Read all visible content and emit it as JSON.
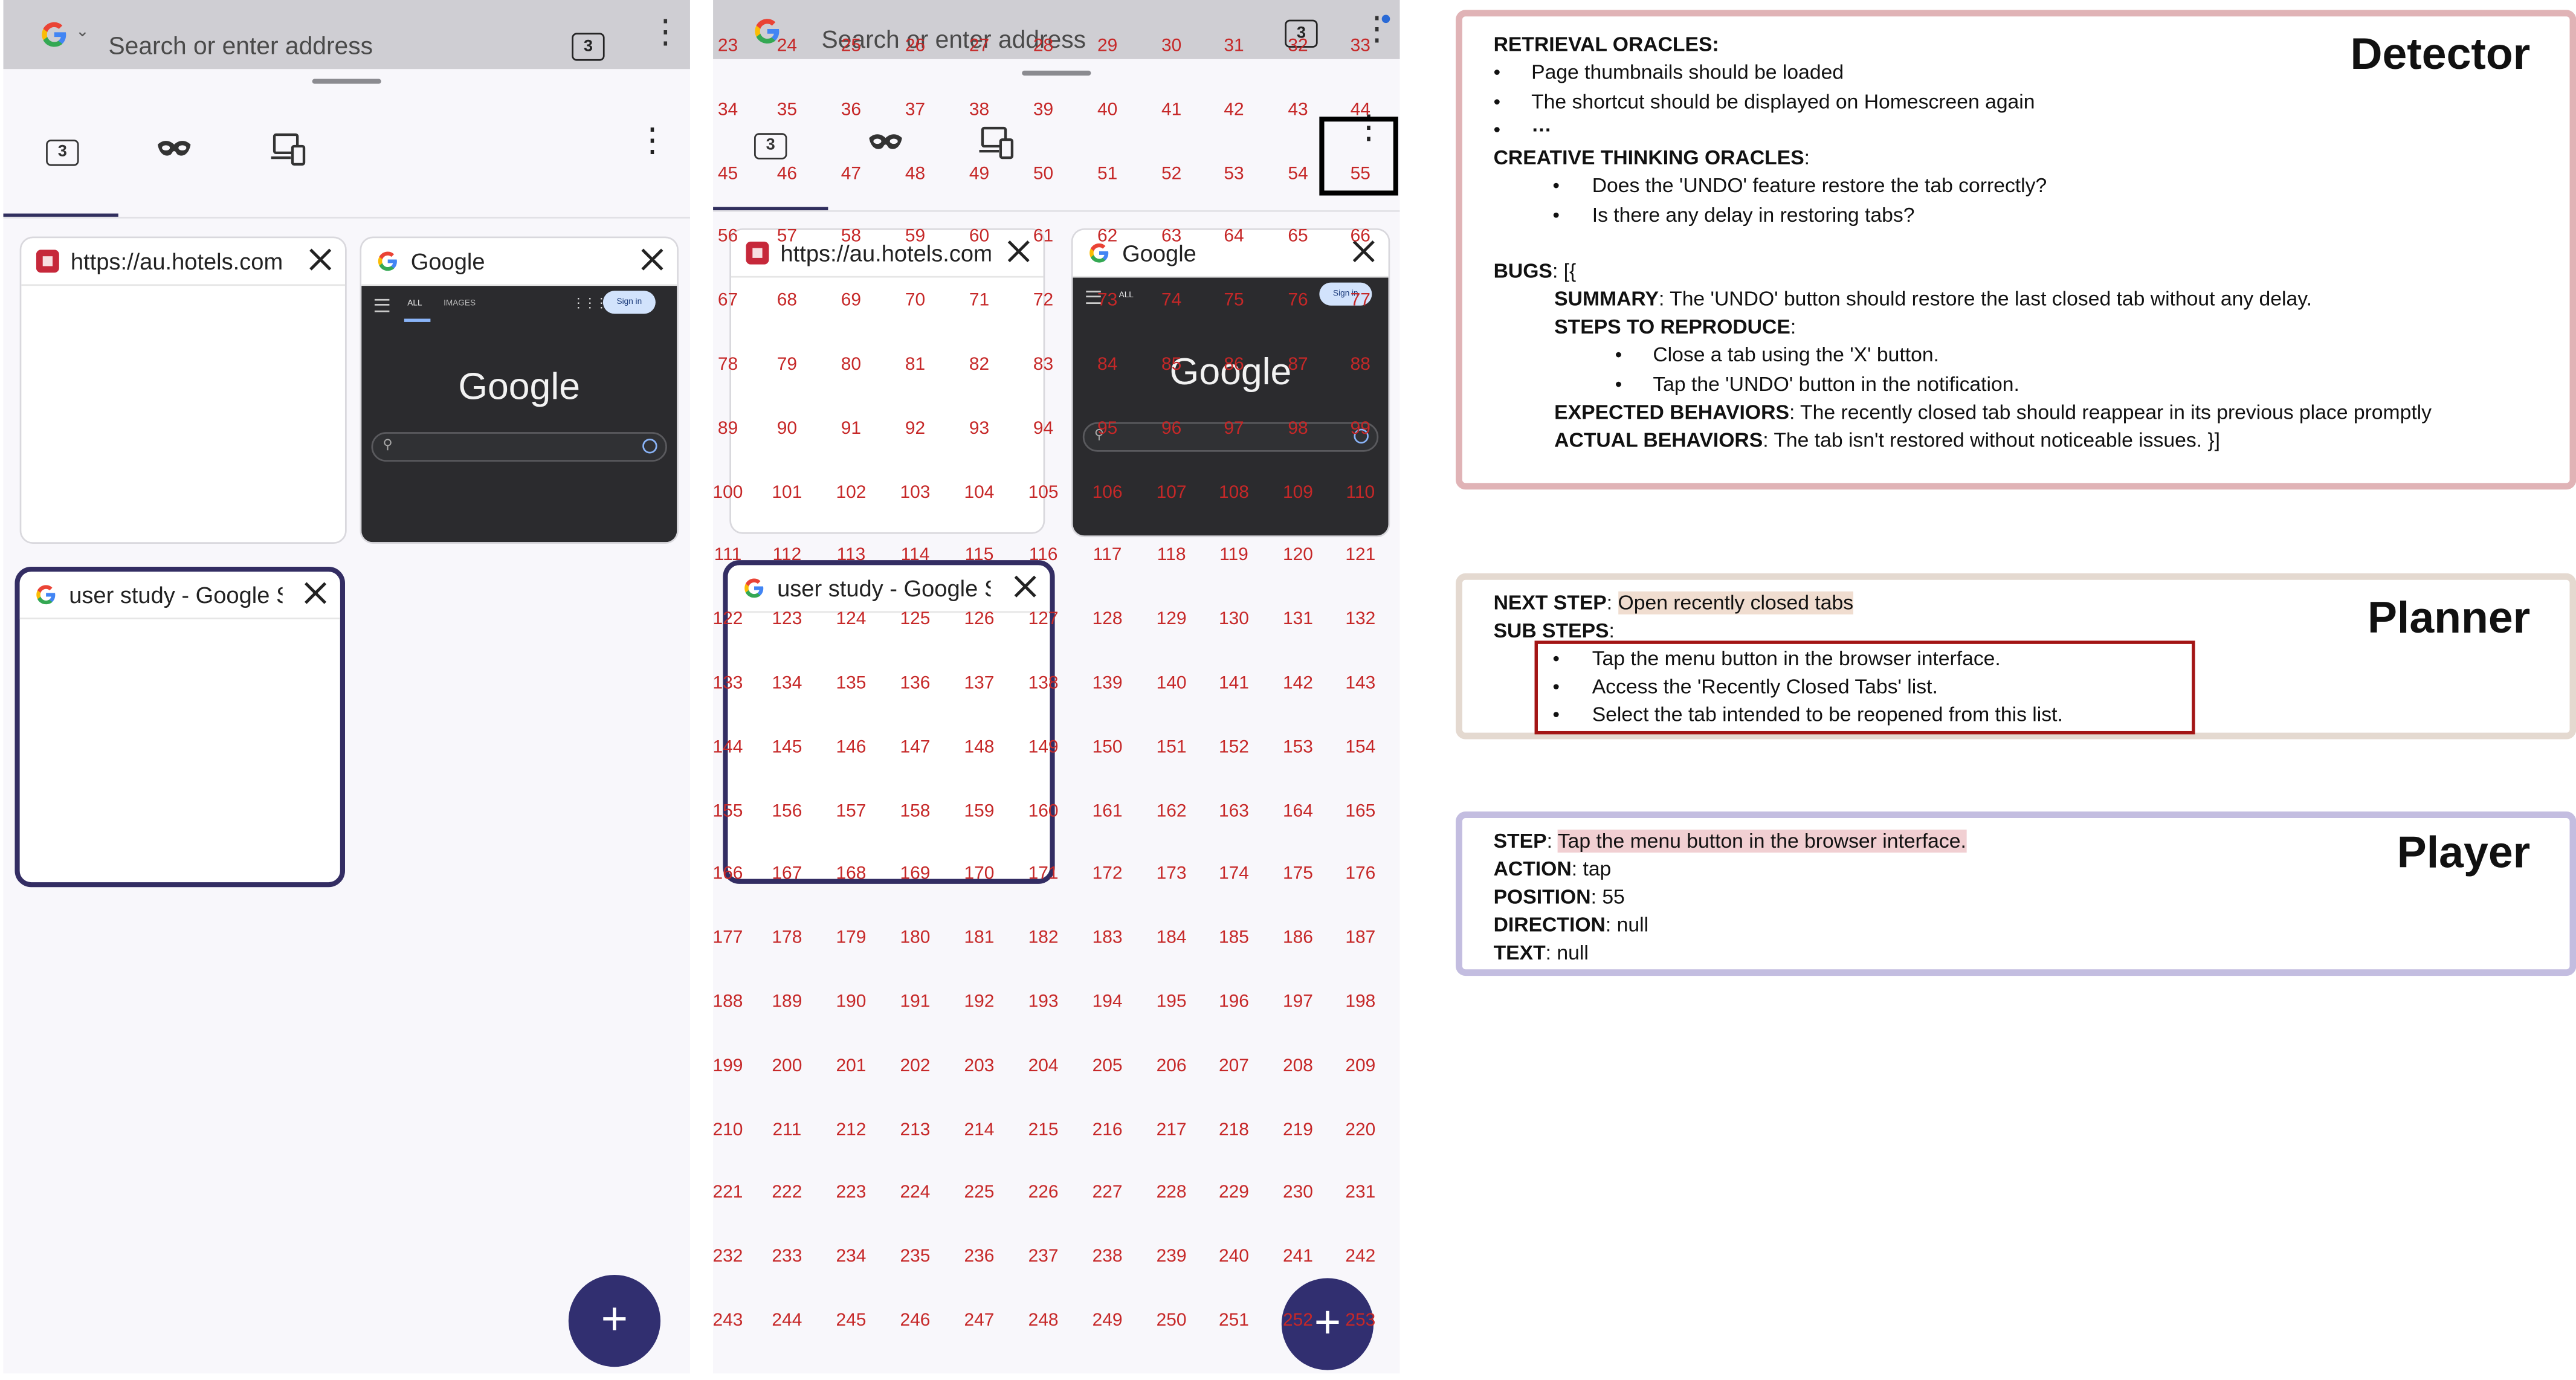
{
  "phone_left": {
    "urlbar": {
      "placeholder": "Search or enter address",
      "tab_count": "3"
    },
    "tabs_tray": {
      "normal_count": "3"
    },
    "cards": [
      {
        "title": "https://au.hotels.com",
        "favicon": "hotels-favicon",
        "thumbnail": "blank"
      },
      {
        "title": "Google",
        "favicon": "google-favicon",
        "thumbnail": "google-homepage-dark"
      },
      {
        "title": "user study - Google Search",
        "favicon": "google-favicon",
        "thumbnail": "blank"
      }
    ],
    "google_thumbnail": {
      "nav_all": "ALL",
      "nav_images": "IMAGES",
      "sign_in": "Sign in",
      "logo": "Google"
    },
    "fab_label": "+"
  },
  "phone_right": {
    "urlbar": {
      "placeholder": "Search or enter address",
      "tab_count": "3"
    },
    "tabs_tray": {
      "normal_count": "3"
    },
    "cards": [
      {
        "title": "https://au.hotels.com"
      },
      {
        "title": "Google"
      },
      {
        "title": "user study - Google Search"
      }
    ],
    "google_thumbnail": {
      "nav_all": "ALL",
      "sign_in": "Sign in",
      "logo": "Google"
    },
    "fab_label": "+",
    "grid_labels": {
      "first": 23,
      "last": 253,
      "columns": 11,
      "highlighted": 55
    }
  },
  "detector": {
    "heading": "Detector",
    "retrieval_label": "RETRIEVAL ORACLES:",
    "retrieval_items": [
      "Page thumbnails should be loaded",
      "The shortcut should be displayed on Homescreen again",
      "…"
    ],
    "creative_label": "CREATIVE THINKING ORACLES",
    "creative_items": [
      "Does the 'UNDO' feature restore the tab correctly?",
      "Is there any delay in restoring tabs?"
    ],
    "bugs_label": "BUGS",
    "bugs_open": ": [{",
    "summary_label": "SUMMARY",
    "summary_text": ": The 'UNDO' button should restore the last closed tab without any delay.",
    "steps_label": "STEPS TO REPRODUCE",
    "steps_items": [
      "Close a tab using the 'X' button.",
      "Tap the 'UNDO' button in the notification."
    ],
    "expected_label": "EXPECTED BEHAVIORS",
    "expected_text": ": The recently closed tab should reappear in its previous place promptly",
    "actual_label": "ACTUAL BEHAVIORS",
    "actual_text": ": The tab isn't restored without noticeable issues. }]"
  },
  "planner": {
    "heading": "Planner",
    "next_step_label": "NEXT STEP",
    "next_step_value": "Open recently closed tabs",
    "sub_steps_label": "SUB STEPS",
    "sub_steps": [
      "Tap the menu button in the browser interface.",
      "Access the 'Recently Closed Tabs' list.",
      "Select the tab intended to be reopened from this list."
    ]
  },
  "player": {
    "heading": "Player",
    "step_label": "STEP",
    "step_value": "Tap the menu button in the browser interface.",
    "action_label": "ACTION",
    "action_value": "tap",
    "position_label": "POSITION",
    "position_value": "55",
    "direction_label": "DIRECTION",
    "direction_value": "null",
    "text_label": "TEXT",
    "text_value": "null"
  },
  "colors": {
    "detector_border": "#e0b3b6",
    "planner_border": "#e4d9d0",
    "player_border": "#c3bde0",
    "grid_label": "#c62828",
    "fab": "#312f70",
    "highlight_pink": "#f1cfd2"
  }
}
